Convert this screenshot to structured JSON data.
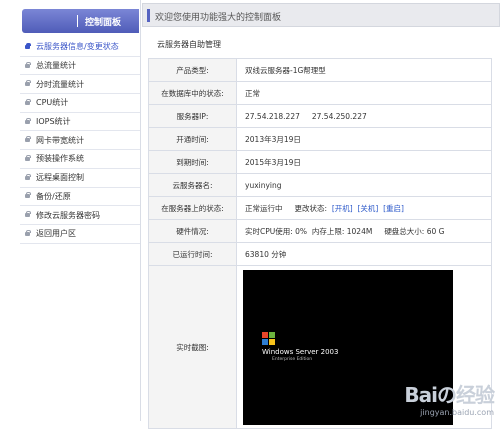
{
  "sidebar": {
    "title": "控制面板",
    "items": [
      {
        "label": "云服务器信息/变更状态",
        "active": true
      },
      {
        "label": "总流量统计"
      },
      {
        "label": "分时流量统计"
      },
      {
        "label": "CPU统计"
      },
      {
        "label": "IOPS统计"
      },
      {
        "label": "网卡带宽统计"
      },
      {
        "label": "预装操作系统"
      },
      {
        "label": "远程桌面控制"
      },
      {
        "label": "备份/还原"
      },
      {
        "label": "修改云服务器密码"
      },
      {
        "label": "返回用户区"
      }
    ]
  },
  "header": {
    "welcome": "欢迎您使用功能强大的控制面板"
  },
  "main": {
    "section_title": "云服务器自助管理",
    "rows": {
      "product_type": {
        "label": "产品类型:",
        "value": "双线云服务器-1G帮理型"
      },
      "db_status": {
        "label": "在数据库中的状态:",
        "value": "正常"
      },
      "ip": {
        "label": "服务器IP:",
        "value1": "27.54.218.227",
        "value2": "27.54.250.227"
      },
      "open_time": {
        "label": "开通时间:",
        "value": "2013年3月19日"
      },
      "expire_time": {
        "label": "到期时间:",
        "value": "2015年3月19日"
      },
      "server_name": {
        "label": "云服务器名:",
        "value": "yuxinying"
      },
      "server_status": {
        "label": "在服务器上的状态:",
        "value": "正常运行中",
        "change_label": "更改状态:",
        "actions": [
          "[开机]",
          "[关机]",
          "[重启]"
        ]
      },
      "hardware": {
        "label": "硬件情况:",
        "cpu": "实时CPU使用: 0%",
        "mem": "内存上限: 1024M",
        "disk": "硬盘总大小: 60 G"
      },
      "uptime": {
        "label": "已运行时间:",
        "value": "63810 分钟"
      },
      "snapshot": {
        "label": "实时截图:",
        "os_title": "Windows Server 2003",
        "os_sub": "Enterprise Edition"
      }
    }
  },
  "watermark": {
    "logo": "Baiの经验",
    "url": "jingyan.baidu.com"
  },
  "colors": {
    "accent": "#4f5cb8",
    "link": "#2a57c9"
  }
}
